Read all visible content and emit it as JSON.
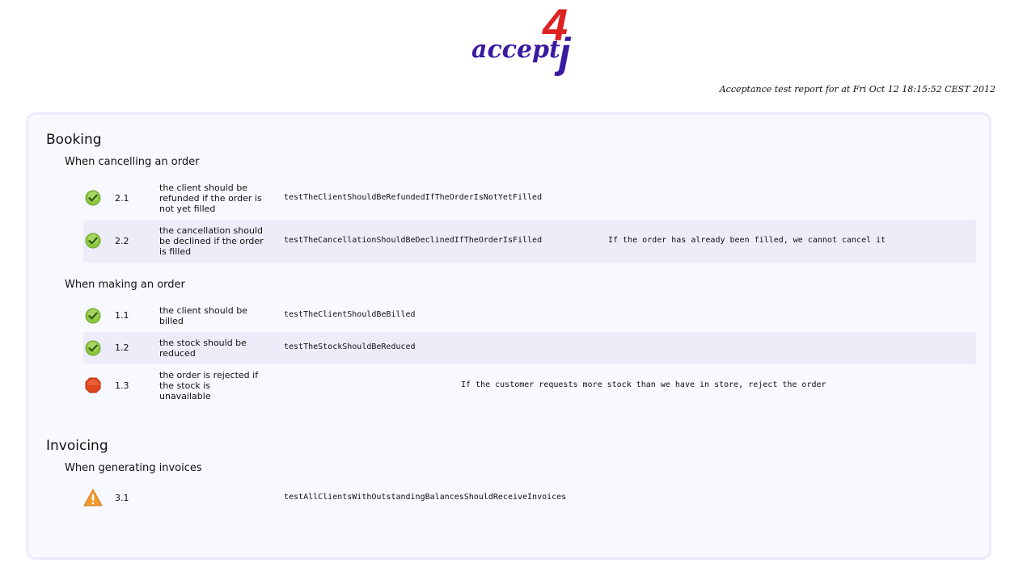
{
  "logo": {
    "word": "accept",
    "number": "4",
    "letter": "j"
  },
  "report_line": "Acceptance test report for at Fri Oct 12 18:15:52 CEST 2012",
  "colors": {
    "pass": "#8dc63f",
    "fail": "#e0461f",
    "warn": "#f29a2e",
    "panel": "#f8f8ff",
    "logo_blue": "#3a1aa0",
    "logo_red": "#dd2222"
  },
  "sections": [
    {
      "title": "Booking",
      "features": [
        {
          "title": "When cancelling an order",
          "tests": [
            {
              "status": "pass",
              "icon": "check-icon",
              "number": "2.1",
              "description": "the client should be refunded if the order is not yet filled",
              "method": "testTheClientShouldBeRefundedIfTheOrderIsNotYetFilled",
              "comment": ""
            },
            {
              "status": "pass",
              "icon": "check-icon",
              "number": "2.2",
              "description": "the cancellation should be declined if the order is filled",
              "method": "testTheCancellationShouldBeDeclinedIfTheOrderIsFilled",
              "comment": "If the order has already been filled, we cannot cancel it"
            }
          ]
        },
        {
          "title": "When making an order",
          "tests": [
            {
              "status": "pass",
              "icon": "check-icon",
              "number": "1.1",
              "description": "the client should be billed",
              "method": "testTheClientShouldBeBilled",
              "comment": ""
            },
            {
              "status": "pass",
              "icon": "check-icon",
              "number": "1.2",
              "description": "the stock should be reduced",
              "method": "testTheStockShouldBeReduced",
              "comment": ""
            },
            {
              "status": "fail",
              "icon": "stop-icon",
              "number": "1.3",
              "description": "the order is rejected if the stock is unavailable",
              "method": "",
              "comment": "If the customer requests more stock than we have in store, reject the order"
            }
          ]
        }
      ]
    },
    {
      "title": "Invoicing",
      "features": [
        {
          "title": "When generating invoices",
          "tests": [
            {
              "status": "warn",
              "icon": "warning-icon",
              "number": "3.1",
              "description": "",
              "method": "testAllClientsWithOutstandingBalancesShouldReceiveInvoices",
              "comment": ""
            }
          ]
        }
      ]
    }
  ]
}
